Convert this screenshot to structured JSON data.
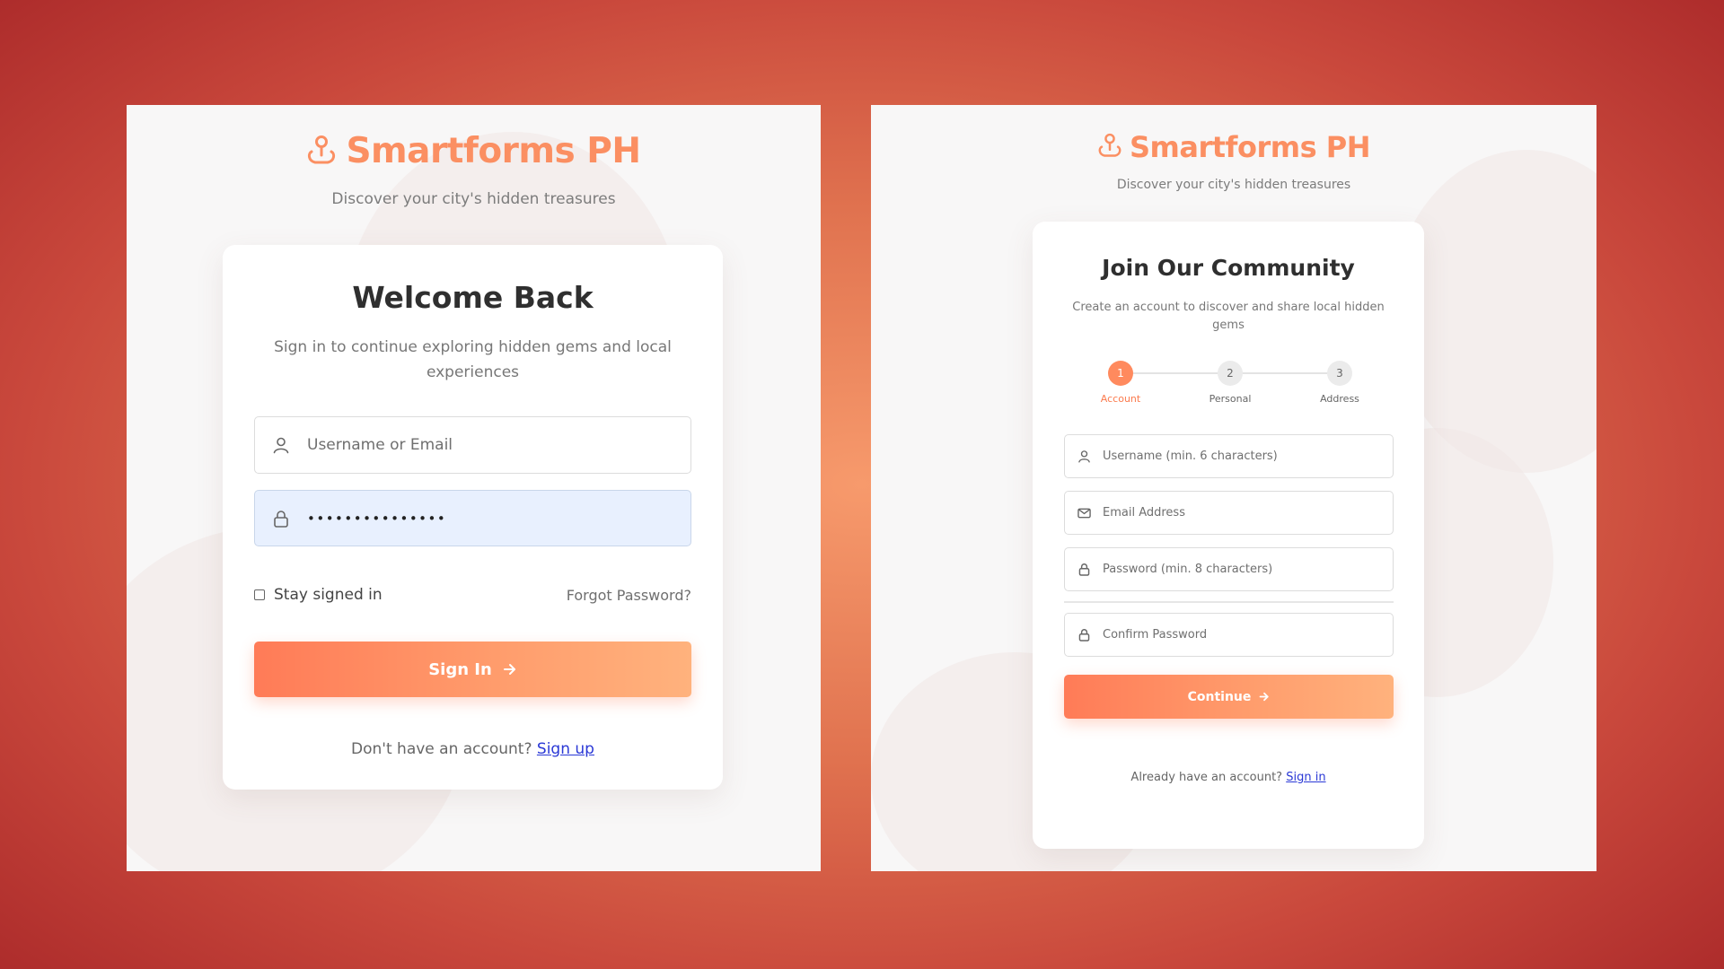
{
  "brand": {
    "name": "Smartforms PH",
    "tagline": "Discover your city's hidden treasures",
    "accent": "#fb8f62",
    "icon": "map-pin-icon"
  },
  "login": {
    "title": "Welcome Back",
    "subtitle": "Sign in to continue exploring hidden gems and local experiences",
    "username_placeholder": "Username or Email",
    "password_value": "•••••••••••••••",
    "remember_label": "Stay signed in",
    "forgot_label": "Forgot Password?",
    "submit_label": "Sign In",
    "footer_text": "Don't have an account?",
    "footer_link": "Sign up"
  },
  "signup": {
    "title": "Join Our Community",
    "subtitle": "Create an account to discover and share local hidden gems",
    "steps": [
      {
        "number": "1",
        "label": "Account",
        "active": true
      },
      {
        "number": "2",
        "label": "Personal",
        "active": false
      },
      {
        "number": "3",
        "label": "Address",
        "active": false
      }
    ],
    "username_placeholder": "Username (min. 6 characters)",
    "email_placeholder": "Email Address",
    "password_placeholder": "Password (min. 8 characters)",
    "confirm_placeholder": "Confirm Password",
    "submit_label": "Continue",
    "footer_text": "Already have an account?",
    "footer_link": "Sign in"
  }
}
